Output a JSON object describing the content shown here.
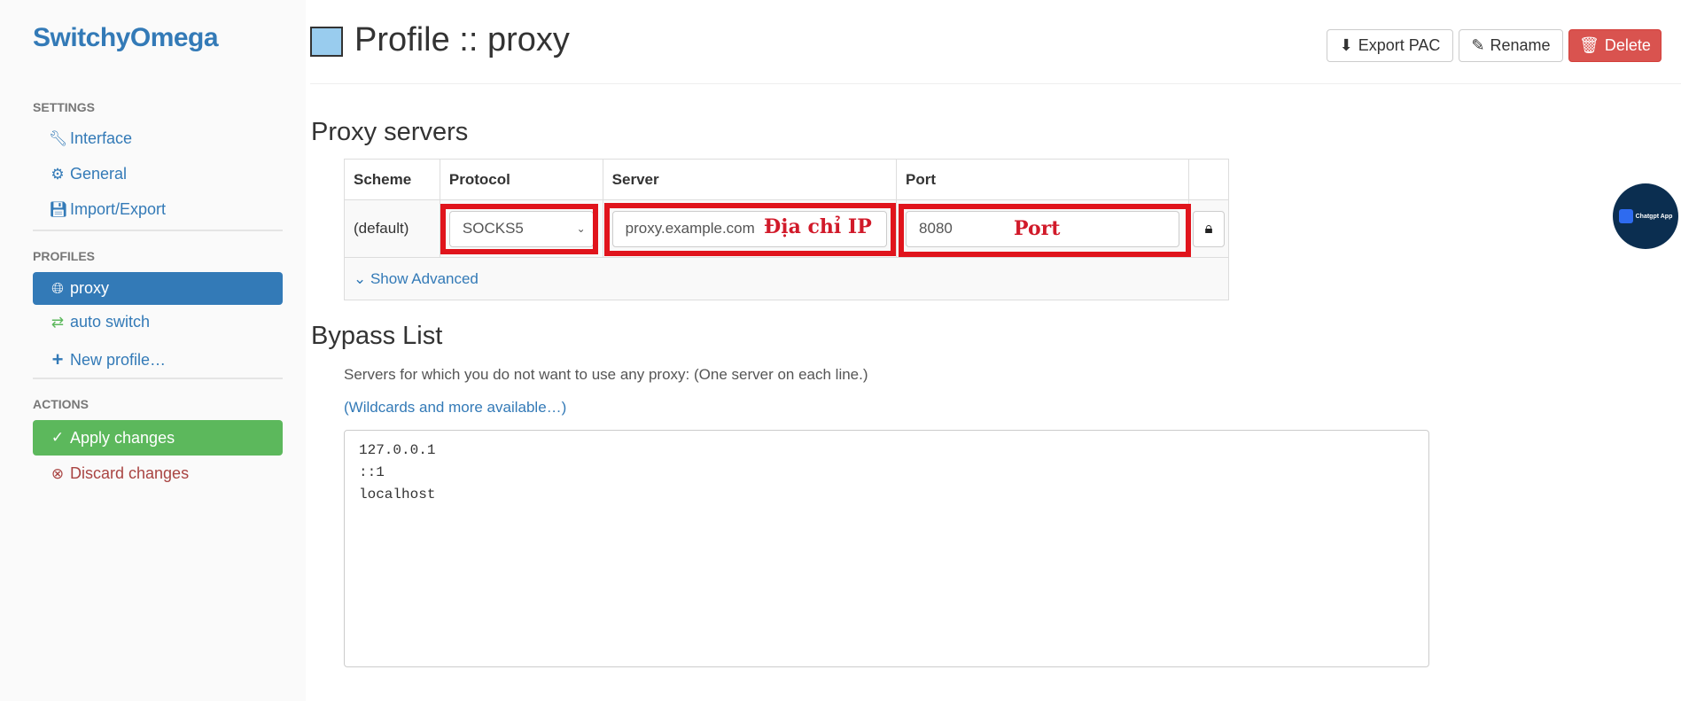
{
  "sidebar": {
    "logo": "SwitchyOmega",
    "settings_heading": "SETTINGS",
    "settings": [
      {
        "label": "Interface",
        "icon": "wrench-icon"
      },
      {
        "label": "General",
        "icon": "gear-icon"
      },
      {
        "label": "Import/Export",
        "icon": "floppy-icon"
      }
    ],
    "profiles_heading": "PROFILES",
    "profiles": [
      {
        "label": "proxy",
        "icon": "globe-icon",
        "active": true
      },
      {
        "label": "auto switch",
        "icon": "retweet-icon"
      },
      {
        "label": "New profile…",
        "icon": "plus-icon"
      }
    ],
    "actions_heading": "ACTIONS",
    "apply": "Apply changes",
    "discard": "Discard changes"
  },
  "header": {
    "title": "Profile :: proxy",
    "profile_color": "#99ccee",
    "export_pac": "Export PAC",
    "rename": "Rename",
    "delete": "Delete"
  },
  "proxy_servers": {
    "heading": "Proxy servers",
    "columns": [
      "Scheme",
      "Protocol",
      "Server",
      "Port"
    ],
    "rows": [
      {
        "scheme": "(default)",
        "protocol": "SOCKS5",
        "server": "proxy.example.com",
        "port": "8080"
      }
    ],
    "show_advanced": "Show Advanced"
  },
  "annotations": {
    "server": "Địa chỉ IP",
    "port": "Port",
    "color": "#e0141c"
  },
  "bypass": {
    "heading": "Bypass List",
    "description": "Servers for which you do not want to use any proxy: (One server on each line.)",
    "wildcards_link": "(Wildcards and more available…)",
    "value": "127.0.0.1\n::1\nlocalhost"
  },
  "floating_badge": {
    "label": "Chatgpt App"
  }
}
